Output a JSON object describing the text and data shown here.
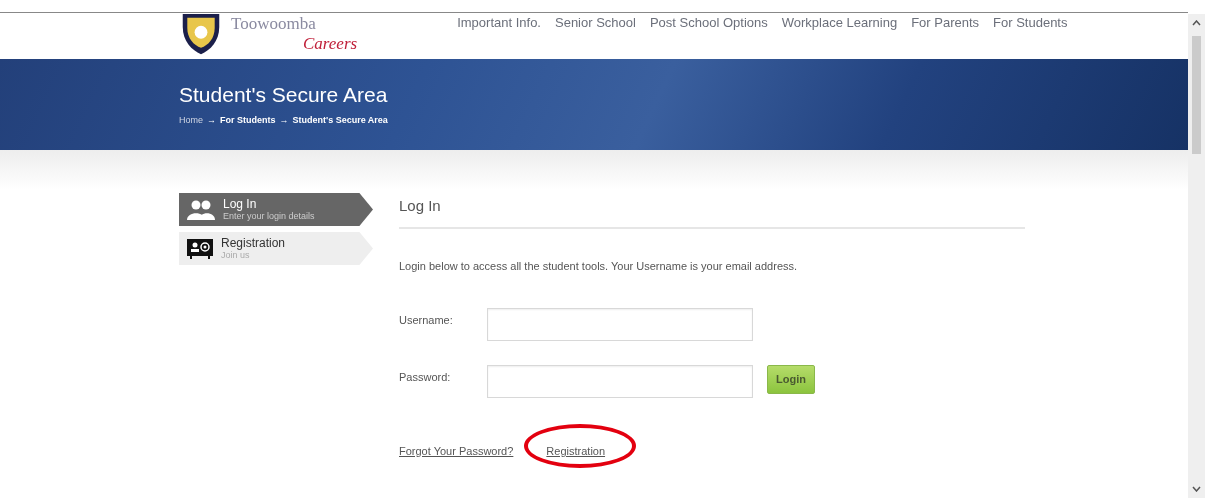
{
  "site": {
    "logo_text": "Toowoomba",
    "logo_tagline": "Careers"
  },
  "nav": [
    "Important Info.",
    "Senior School",
    "Post School Options",
    "Workplace Learning",
    "For Parents",
    "For Students"
  ],
  "banner": {
    "title": "Student's Secure Area",
    "breadcrumb": [
      {
        "text": "Home",
        "kind": "link"
      },
      {
        "text": "→",
        "kind": "separator"
      },
      {
        "text": "For Students",
        "kind": "current"
      },
      {
        "text": "→",
        "kind": "separator"
      },
      {
        "text": "Student's Secure Area",
        "kind": "current"
      }
    ]
  },
  "side_menu": [
    {
      "title": "Log In",
      "subtitle": "Enter your login details",
      "kind": "users",
      "selected": true
    },
    {
      "title": "Registration",
      "subtitle": "Join us",
      "kind": "card",
      "selected": false
    }
  ],
  "login": {
    "heading": "Log In",
    "intro": "Login below to access all the student tools. Your Username is your email address.",
    "fields": [
      {
        "label": "Username:"
      },
      {
        "label": "Password:"
      }
    ],
    "button": "Login",
    "links": [
      {
        "text": "Forgot Your Password?",
        "highlighted": false
      },
      {
        "text": "Registration",
        "highlighted": true
      }
    ]
  }
}
